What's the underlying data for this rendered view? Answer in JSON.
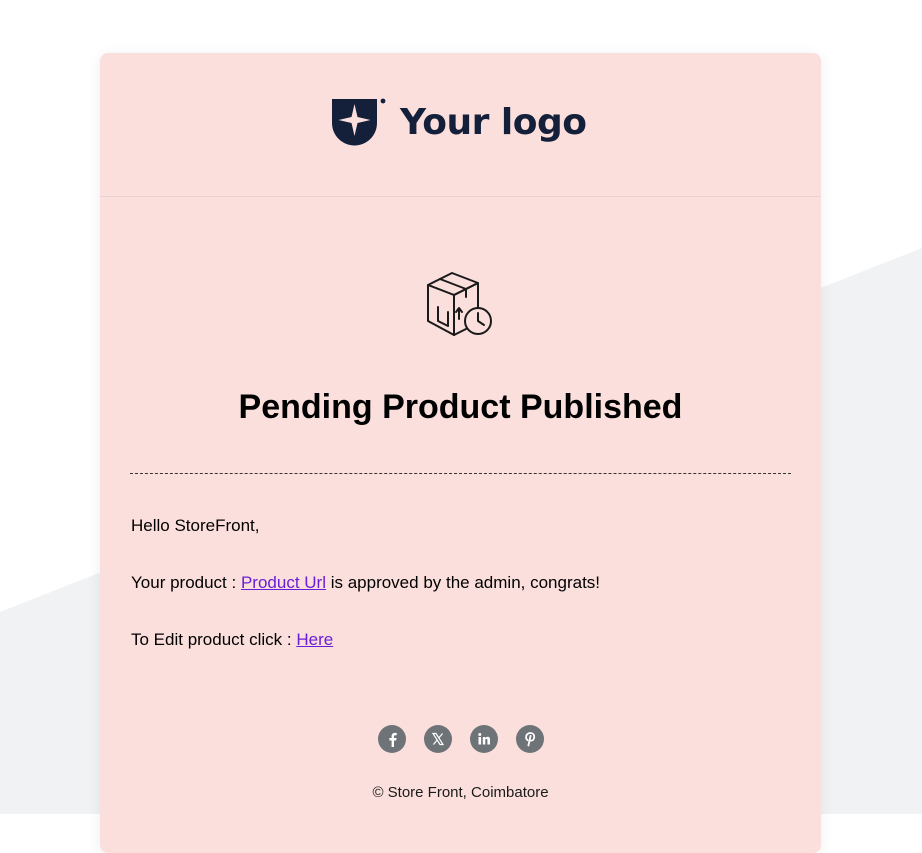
{
  "header": {
    "logo_text": "Your logo"
  },
  "email": {
    "title": "Pending Product Published",
    "greeting": "Hello StoreFront,",
    "product_line_prefix": "Your product : ",
    "product_link_text": "Product Url",
    "product_line_suffix": " is approved by the admin, congrats!",
    "edit_line_prefix": "To Edit product click : ",
    "edit_link_text": "Here"
  },
  "social": {
    "icons": [
      "facebook-icon",
      "x-icon",
      "linkedin-icon",
      "pinterest-icon"
    ]
  },
  "footer": {
    "text": "© Store Front, Coimbatore"
  },
  "colors": {
    "card_background": "#fbdfdc",
    "link": "#6a1fd6",
    "logo": "#14203a",
    "social_icon": "#6e7378"
  }
}
